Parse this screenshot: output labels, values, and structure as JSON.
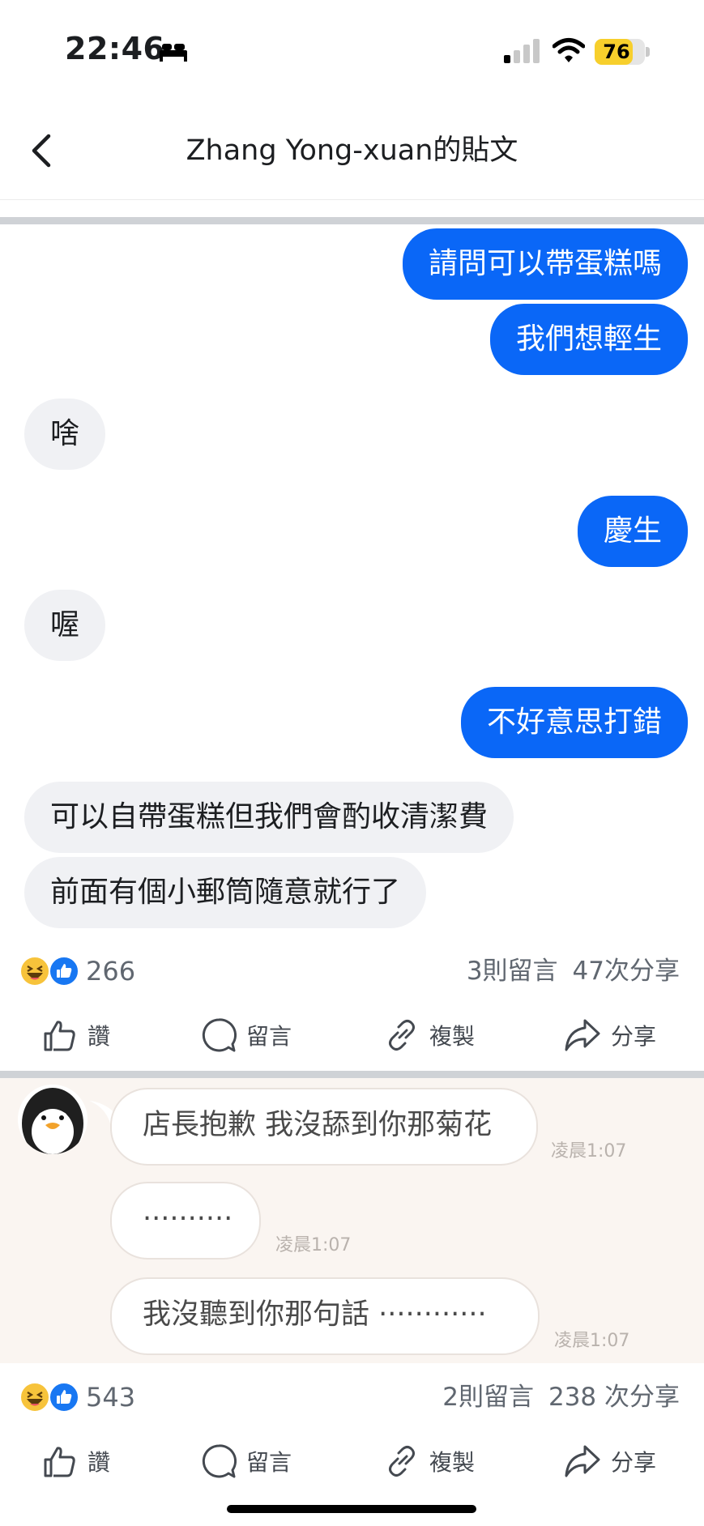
{
  "status_bar": {
    "time": "22:46",
    "battery": "76",
    "battery_level": 0.76
  },
  "header": {
    "title": "Zhang Yong-xuan的貼文"
  },
  "post1": {
    "messages": [
      {
        "side": "out",
        "text": "請問可以帶蛋糕嗎"
      },
      {
        "side": "out",
        "text": "我們想輕生"
      },
      {
        "side": "in",
        "text": "啥"
      },
      {
        "side": "out",
        "text": "慶生"
      },
      {
        "side": "in",
        "text": "喔"
      },
      {
        "side": "out",
        "text": "不好意思打錯"
      },
      {
        "side": "in",
        "text": "可以自帶蛋糕但我們會酌收清潔費"
      },
      {
        "side": "in",
        "text": "前面有個小郵筒隨意就行了"
      }
    ],
    "reaction_count": "266",
    "comments": "3則留言",
    "shares": "47次分享"
  },
  "post2": {
    "messages": [
      {
        "text": "店長抱歉 我沒舔到你那菊花",
        "time": "凌晨1:07"
      },
      {
        "text": "··········",
        "time": "凌晨1:07"
      },
      {
        "text": "我沒聽到你那句話 ············",
        "time": "凌晨1:07"
      }
    ],
    "reaction_count": "543",
    "comments": "2則留言",
    "shares": "238 次分享"
  },
  "actions": {
    "like": "讚",
    "comment": "留言",
    "copy": "複製",
    "share": "分享"
  },
  "colors": {
    "accent": "#0a67f7",
    "incoming_bubble": "#f0f1f4",
    "battery": "#f7cf2c"
  }
}
